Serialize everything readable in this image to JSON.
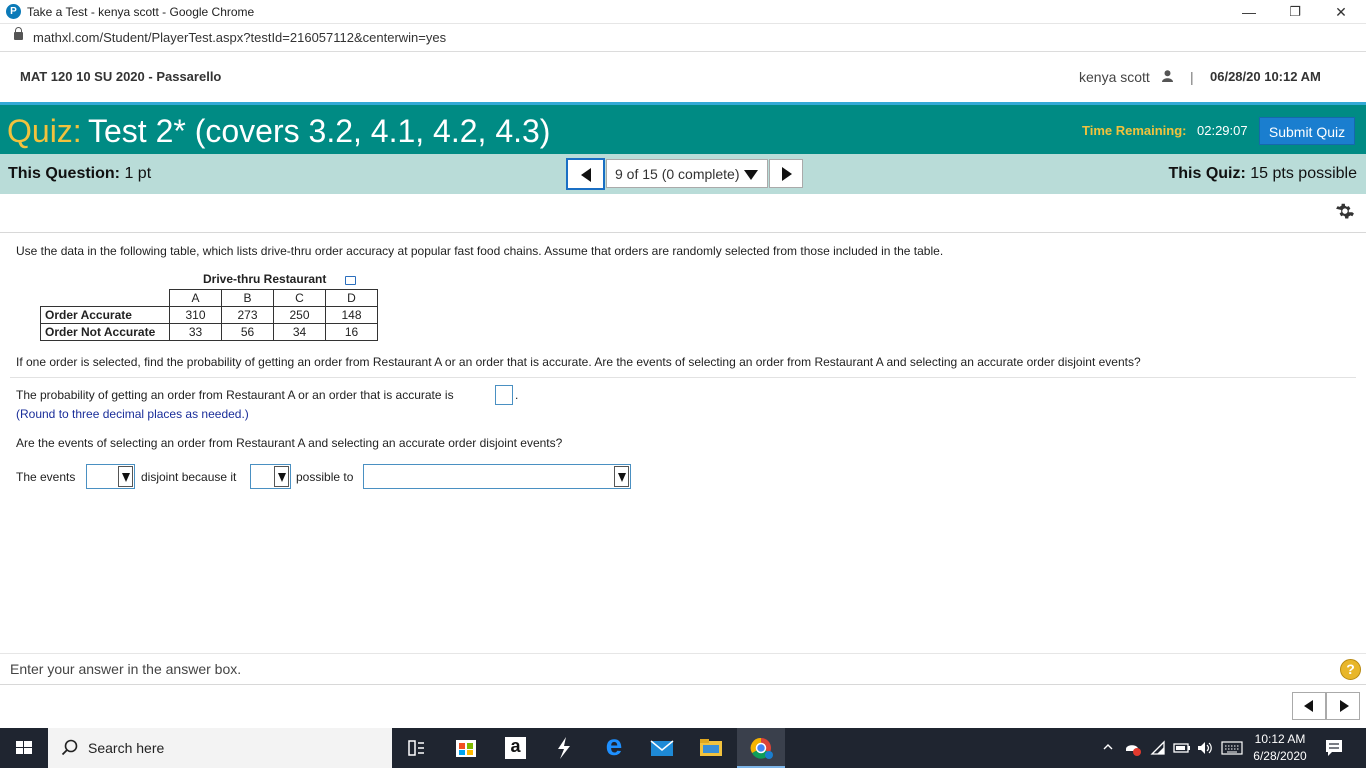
{
  "browser": {
    "window_title": "Take a Test - kenya scott - Google Chrome",
    "url": "mathxl.com/Student/PlayerTest.aspx?testId=216057112&centerwin=yes",
    "favicon_letter": "P",
    "minimize_glyph": "—",
    "restore_glyph": "❐",
    "close_glyph": "✕"
  },
  "header": {
    "course": "MAT 120 10 SU 2020 - Passarello",
    "user": "kenya scott",
    "separator": "|",
    "datetime": "06/28/20 10:12 AM"
  },
  "quiz": {
    "label": "Quiz:",
    "name": "Test 2* (covers 3.2, 4.1, 4.2, 4.3)",
    "time_label": "Time Remaining:",
    "time_value": "02:29:07",
    "submit_label": "Submit Quiz"
  },
  "nav": {
    "question_label": "This Question:",
    "question_points": "1 pt",
    "selector_text": "9 of 15 (0 complete)",
    "quiz_label": "This Quiz:",
    "quiz_points": "15 pts possible"
  },
  "question": {
    "intro": "Use the data in the following table, which lists drive-thru order accuracy at popular fast food chains. Assume that orders are randomly selected from those included in the table.",
    "table_title": "Drive-thru Restaurant",
    "table": {
      "columns": [
        "A",
        "B",
        "C",
        "D"
      ],
      "rows": [
        {
          "label": "Order Accurate",
          "values": [
            "310",
            "273",
            "250",
            "148"
          ]
        },
        {
          "label": "Order Not Accurate",
          "values": [
            "33",
            "56",
            "34",
            "16"
          ]
        }
      ]
    },
    "prompt": "If one order is selected, find the probability of getting an order from Restaurant A or an order that is accurate. Are the events of selecting an order from Restaurant A and selecting an accurate order disjoint events?",
    "part1_text": "The probability of getting an order from Restaurant A or an order that is accurate is",
    "part1_suffix": ".",
    "part1_hint": "(Round to three decimal places as needed.)",
    "part2_text": "Are the events of selecting an order from Restaurant A and selecting an accurate order disjoint events?",
    "sentence_start": "The events",
    "sentence_mid1": "disjoint because it",
    "sentence_mid2": "possible to"
  },
  "footer": {
    "hint": "Enter your answer in the answer box.",
    "help_label": "?"
  },
  "taskbar": {
    "search_placeholder": "Search here",
    "clock_time": "10:12 AM",
    "clock_date": "6/28/2020",
    "amazon_letter": "a",
    "edge_letter": "e"
  }
}
